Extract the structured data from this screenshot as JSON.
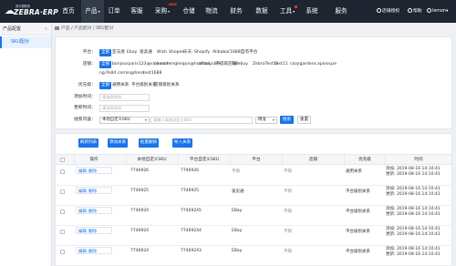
{
  "app": {
    "logo_sub": "斑马物联网",
    "logo_brand": "ZEBRA·ERP"
  },
  "nav": {
    "items": [
      {
        "label": "首页",
        "active": false
      },
      {
        "label": "产品",
        "active": true,
        "dropdown": true
      },
      {
        "label": "订单",
        "active": false
      },
      {
        "label": "客服",
        "active": false
      },
      {
        "label": "采购",
        "active": false,
        "badge": "NEW",
        "dropdown": true
      },
      {
        "label": "仓储",
        "active": false
      },
      {
        "label": "物流",
        "active": false
      },
      {
        "label": "财务",
        "active": false
      },
      {
        "label": "数据",
        "active": false
      },
      {
        "label": "工具",
        "active": false,
        "dot": true,
        "dropdown": true
      },
      {
        "label": "系统",
        "active": false
      },
      {
        "label": "服务",
        "active": false
      }
    ],
    "right": {
      "auth": "店铺授权",
      "help": "帮助",
      "user": "lemon",
      "user_dd": "▾"
    }
  },
  "sidebar": {
    "header": "产品配置",
    "collapse_icon": "«",
    "items": [
      {
        "label": "SKU配对",
        "active": true
      }
    ]
  },
  "breadcrumb": {
    "text": "产品 / 产品配对 / SKU配对"
  },
  "filter": {
    "platform_label": "平台：",
    "platforms": [
      "全部",
      "亚马逊",
      "Ebay",
      "速卖通",
      "Wish",
      "Shopee",
      "乐天",
      "Shopify",
      "Alibaba(1688)",
      "自有平台"
    ],
    "shop_label": "店铺：",
    "shops": [
      "全部",
      "bonjourparis123@sina.com",
      "chenchengleiqun@hotmail.com",
      "aliboy（不提取店铺）",
      "Totebuy",
      "ZebraTest11",
      "test11",
      "cozygardens",
      "apoiocpe"
    ],
    "shops_row2": [
      "ng.Polld",
      "comingdress",
      "test1688"
    ],
    "priority_label": "优先级：",
    "priorities": [
      "全部",
      "通用关系",
      "平台级别关系",
      "店铺级别关系"
    ],
    "add_time_label": "添加时间：",
    "add_time_placeholder": "请选择时间",
    "update_time_label": "更新时间：",
    "update_time_placeholder": "请选择时间",
    "search_label": "搜索内容：",
    "search_select": "本地自定义SKU",
    "search_placeholder": "请输入本地自定义SKU",
    "match_select": "精准",
    "search_btn": "搜索",
    "reset_btn": "重置"
  },
  "toolbar": {
    "refresh": "刷新列表",
    "add": "添加关系",
    "batch_delete": "批量删除",
    "import": "导入关系"
  },
  "table": {
    "headers": [
      "操作",
      "本地自定义SKU",
      "平台自定义SKU",
      "平台",
      "店铺",
      "优先级",
      "时间"
    ],
    "edit_label": "编辑",
    "delete_label": "删除",
    "rows": [
      {
        "local_sku": "7746926",
        "platform_sku": "7746926",
        "platform": "不限",
        "shop": "不限",
        "priority": "通用关系",
        "added": "添加: 2019-08-16 14:10:41",
        "updated": "更新: 2019-08-16 14:10:41"
      },
      {
        "local_sku": "7746925",
        "platform_sku": "7746925",
        "platform": "速卖通",
        "shop": "不限",
        "priority": "平台级别关系",
        "added": "添加: 2019-08-16 14:10:41",
        "updated": "更新: 2019-08-16 14:10:41"
      },
      {
        "local_sku": "7746924",
        "platform_sku": "77469245",
        "platform": "EBay",
        "shop": "不限",
        "priority": "平台级别关系",
        "added": "添加: 2019-08-16 14:10:41",
        "updated": "更新: 2019-08-16 14:10:41"
      },
      {
        "local_sku": "7746924",
        "platform_sku": "77469244",
        "platform": "EBay",
        "shop": "不限",
        "priority": "平台级别关系",
        "added": "添加: 2019-08-16 14:10:41",
        "updated": "更新: 2019-08-16 14:10:41"
      },
      {
        "local_sku": "7746924",
        "platform_sku": "77469243",
        "platform": "EBay",
        "shop": "不限",
        "priority": "平台级别关系",
        "added": "添加: 2019-08-16 14:10:41",
        "updated": "更新: 2019-08-16 14:10:41"
      }
    ]
  },
  "colors": {
    "accent": "#1a73e8",
    "topbar": "#1f2530"
  }
}
